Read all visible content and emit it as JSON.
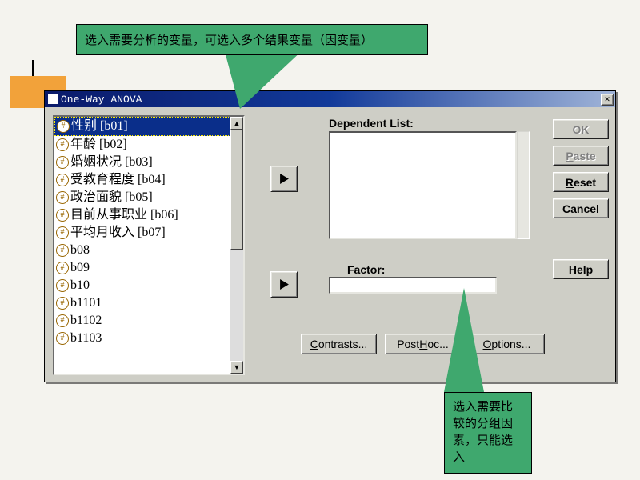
{
  "callouts": {
    "top": "选入需要分析的变量，可选入多个结果变量（因变量）",
    "bottom": "选入需要比较的分组因素，只能选入"
  },
  "dialog": {
    "title": "One-Way ANOVA",
    "close_x": "✕"
  },
  "listbox": {
    "items": [
      {
        "label": "性别 [b01]",
        "selected": true
      },
      {
        "label": "年龄 [b02]"
      },
      {
        "label": "婚姻状况 [b03]"
      },
      {
        "label": "受教育程度 [b04]"
      },
      {
        "label": "政治面貌 [b05]"
      },
      {
        "label": "目前从事职业 [b06]"
      },
      {
        "label": "平均月收入 [b07]"
      },
      {
        "label": "b08"
      },
      {
        "label": "b09"
      },
      {
        "label": "b10"
      },
      {
        "label": "b1101"
      },
      {
        "label": "b1102"
      },
      {
        "label": "b1103"
      }
    ]
  },
  "labels": {
    "dependent": "Dependent List:",
    "factor": "Factor:"
  },
  "bottom_buttons": {
    "contrasts": {
      "pre": "",
      "ul": "C",
      "post": "ontrasts..."
    },
    "posthoc": {
      "pre": "Post ",
      "ul": "H",
      "post": "oc..."
    },
    "options": {
      "pre": "",
      "ul": "O",
      "post": "ptions..."
    }
  },
  "right_buttons": {
    "ok": "OK",
    "paste": {
      "pre": "",
      "ul": "P",
      "post": "aste"
    },
    "reset": {
      "pre": "",
      "ul": "R",
      "post": "eset"
    },
    "cancel": "Cancel",
    "help": "Help"
  }
}
